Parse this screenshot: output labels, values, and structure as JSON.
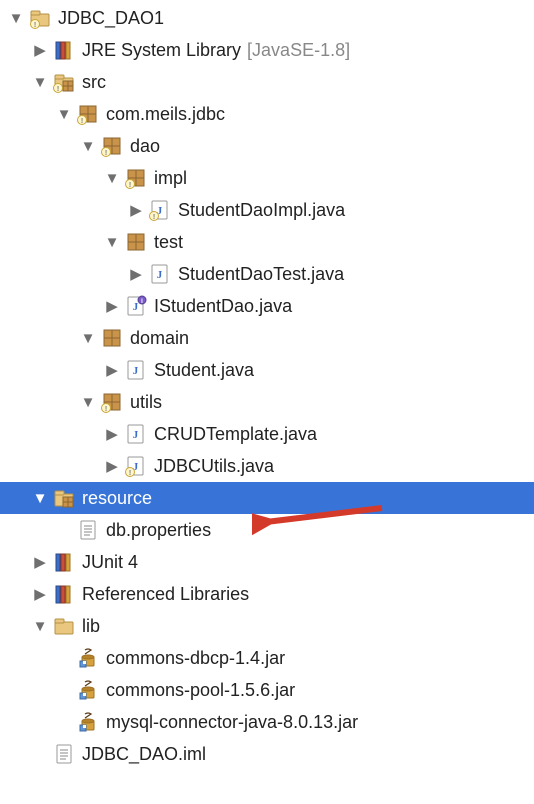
{
  "tree": {
    "project_name": "JDBC_DAO1",
    "jre_library": "JRE System Library",
    "jre_version": "[JavaSE-1.8]",
    "src": "src",
    "package_root": "com.meils.jdbc",
    "pkg_dao": "dao",
    "pkg_impl": "impl",
    "file_student_dao_impl": "StudentDaoImpl.java",
    "pkg_test": "test",
    "file_student_dao_test": "StudentDaoTest.java",
    "file_istudent_dao": "IStudentDao.java",
    "pkg_domain": "domain",
    "file_student": "Student.java",
    "pkg_utils": "utils",
    "file_crud_template": "CRUDTemplate.java",
    "file_jdbc_utils": "JDBCUtils.java",
    "folder_resource": "resource",
    "file_db_properties": "db.properties",
    "junit": "JUnit 4",
    "ref_libs": "Referenced Libraries",
    "folder_lib": "lib",
    "jar_dbcp": "commons-dbcp-1.4.jar",
    "jar_pool": "commons-pool-1.5.6.jar",
    "jar_mysql": "mysql-connector-java-8.0.13.jar",
    "file_iml": "JDBC_DAO.iml"
  }
}
